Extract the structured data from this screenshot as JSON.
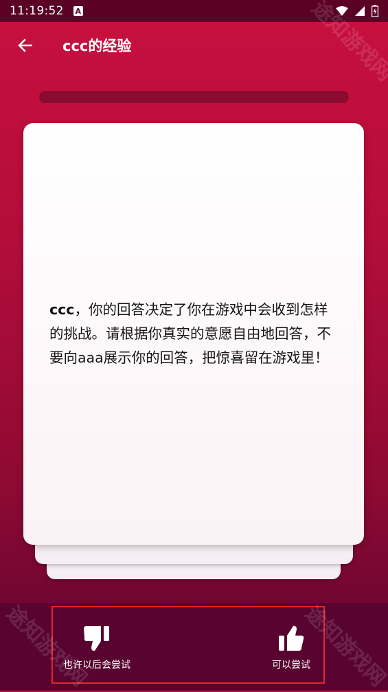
{
  "status_bar": {
    "time": "11:19:52",
    "notification_letter": "A"
  },
  "header": {
    "title": "ccc的经验"
  },
  "question": {
    "name": "ccc",
    "text": "，你的回答决定了你在游戏中会收到怎样的挑战。请根据你真实的意愿自由地回答，不要向aaa展示你的回答，把惊喜留在游戏里！"
  },
  "actions": {
    "dislike_label": "也许以后会尝试",
    "like_label": "可以尝试"
  },
  "watermark": "途知游戏网",
  "colors": {
    "accent": "#c8103f",
    "bottom_bar": "#580330",
    "highlight_frame": "#e02828"
  }
}
